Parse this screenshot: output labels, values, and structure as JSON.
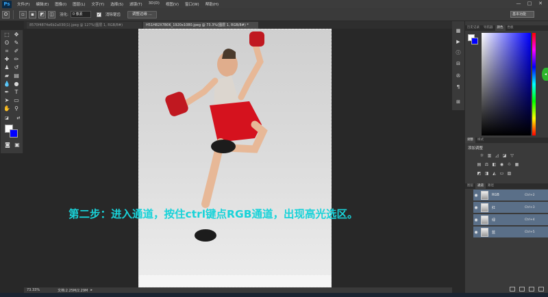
{
  "app": {
    "logo": "Ps"
  },
  "menu": [
    "文件(F)",
    "编辑(E)",
    "图像(I)",
    "图层(L)",
    "文字(Y)",
    "选择(S)",
    "滤镜(T)",
    "3D(D)",
    "视图(V)",
    "窗口(W)",
    "帮助(H)"
  ],
  "window_controls": [
    "—",
    "□",
    "✕"
  ],
  "options_bar": {
    "feather_label": "羽化:",
    "feather_value": "0 像素",
    "antialias_label": "消除锯齿",
    "antialias_checked": true,
    "refine_edge_label": "调整边缘 ...",
    "workspace": "基本功能"
  },
  "tabs": [
    {
      "label": "8570f4874e6b2a030(1).jpeg @ 127%(图层 1, RGB/8#)",
      "active": false
    },
    {
      "label": "H51H82X7B0K_1920x1080.jpeg @ 73.3%(图层 1, RGB/8#) *",
      "active": true
    }
  ],
  "overlay_text": "第二步：进入通道，按住ctrl键点RGB通道，出现高光选区。",
  "status": {
    "zoom": "73.33%",
    "doc_info": "文档:2.25M/2.29M"
  },
  "panels": {
    "top_tabs": [
      "历史记录",
      "导航器",
      "颜色",
      "色板"
    ],
    "active_top_tab": "颜色",
    "adjust_tabs": [
      "调整",
      "样式"
    ],
    "adjust_title": "添加调整",
    "layers_tabs": [
      "图层",
      "通道",
      "路径"
    ],
    "active_layers_tab": "通道"
  },
  "colors": {
    "foreground": "#ffffff",
    "background": "#0000ff",
    "overlay": "#19d3d9",
    "selected_row": "#5a6f88"
  },
  "channels": [
    {
      "name": "RGB",
      "shortcut": "Ctrl+2"
    },
    {
      "name": "红",
      "shortcut": "Ctrl+3"
    },
    {
      "name": "绿",
      "shortcut": "Ctrl+4"
    },
    {
      "name": "蓝",
      "shortcut": "Ctrl+5"
    }
  ]
}
